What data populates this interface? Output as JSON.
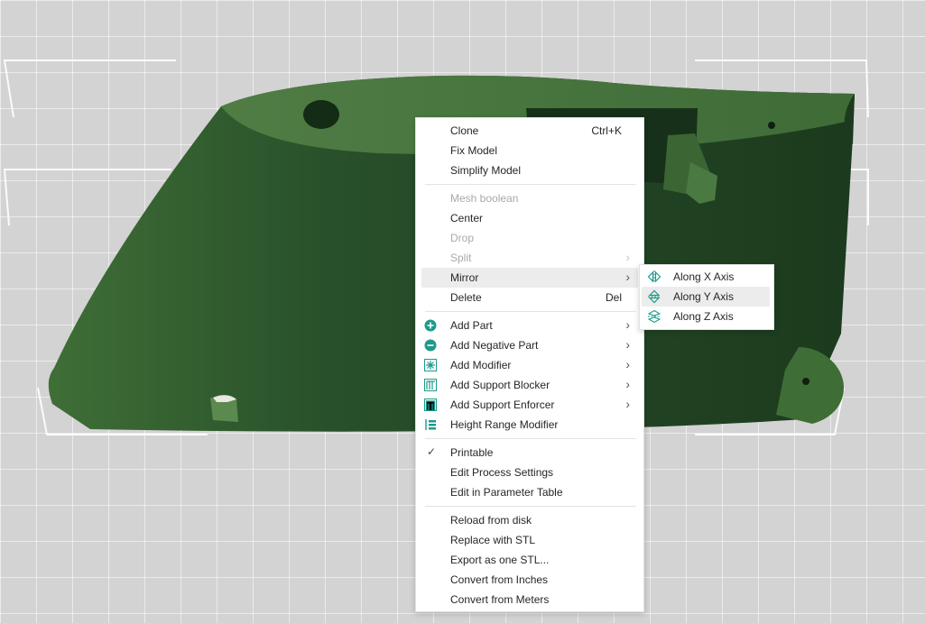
{
  "context_menu": {
    "items": [
      {
        "label": "Clone",
        "shortcut": "Ctrl+K"
      },
      {
        "label": "Fix Model"
      },
      {
        "label": "Simplify Model"
      },
      {
        "label": "Mesh boolean",
        "disabled": true
      },
      {
        "label": "Center"
      },
      {
        "label": "Drop",
        "disabled": true
      },
      {
        "label": "Split",
        "disabled": true,
        "submenu": true
      },
      {
        "label": "Mirror",
        "submenu": true,
        "highlighted": true
      },
      {
        "label": "Delete",
        "shortcut": "Del"
      },
      {
        "label": "Add Part",
        "icon": "add-part-icon",
        "submenu": true
      },
      {
        "label": "Add Negative Part",
        "icon": "add-negative-part-icon",
        "submenu": true
      },
      {
        "label": "Add Modifier",
        "icon": "add-modifier-icon",
        "submenu": true
      },
      {
        "label": "Add Support Blocker",
        "icon": "support-blocker-icon",
        "submenu": true
      },
      {
        "label": "Add Support Enforcer",
        "icon": "support-enforcer-icon",
        "submenu": true
      },
      {
        "label": "Height Range Modifier",
        "icon": "height-range-icon"
      },
      {
        "label": "Printable",
        "checked": true
      },
      {
        "label": "Edit Process Settings"
      },
      {
        "label": "Edit in Parameter Table"
      },
      {
        "label": "Reload from disk"
      },
      {
        "label": "Replace with STL"
      },
      {
        "label": "Export as one STL..."
      },
      {
        "label": "Convert from Inches"
      },
      {
        "label": "Convert from Meters"
      }
    ]
  },
  "mirror_submenu": {
    "items": [
      {
        "label": "Along X Axis",
        "icon": "mirror-x-icon"
      },
      {
        "label": "Along Y Axis",
        "icon": "mirror-y-icon",
        "highlighted": true
      },
      {
        "label": "Along Z Axis",
        "icon": "mirror-z-icon"
      }
    ]
  },
  "colors": {
    "model_dark": "#1f3a1f",
    "model_mid": "#2d5a2d",
    "model_top": "#4c7a40",
    "accent": "#1e9a8a"
  }
}
